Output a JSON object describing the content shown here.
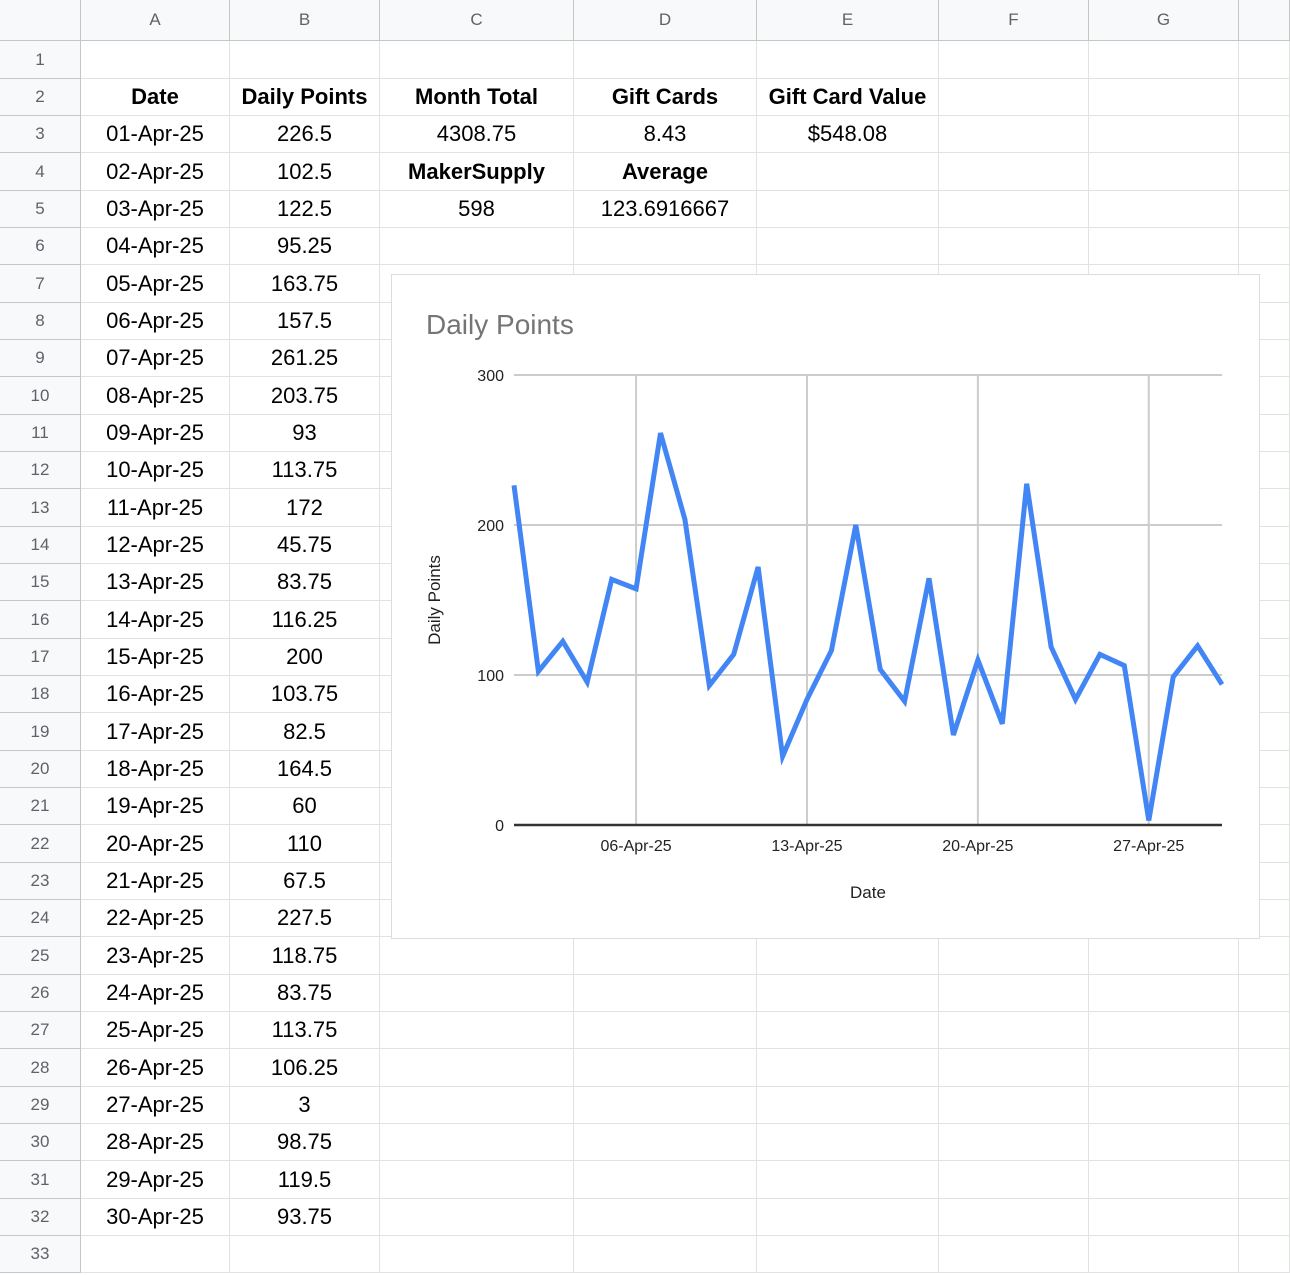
{
  "columns": [
    "A",
    "B",
    "C",
    "D",
    "E",
    "F",
    "G"
  ],
  "rows": [
    "1",
    "2",
    "3",
    "4",
    "5",
    "6",
    "7",
    "8",
    "9",
    "10",
    "11",
    "12",
    "13",
    "14",
    "15",
    "16",
    "17",
    "18",
    "19",
    "20",
    "21",
    "22",
    "23",
    "24",
    "25",
    "26",
    "27",
    "28",
    "29",
    "30",
    "31",
    "32",
    "33"
  ],
  "cells": {
    "A2": "Date",
    "B2": "Daily Points",
    "C2": "Month Total",
    "D2": "Gift Cards",
    "E2": "Gift Card Value",
    "C3": "4308.75",
    "D3": "8.43",
    "E3": "$548.08",
    "C4": "MakerSupply",
    "D4": "Average",
    "C5": "598",
    "D5": "123.6916667"
  },
  "bold_cells": [
    "A2",
    "B2",
    "C2",
    "D2",
    "E2",
    "C4",
    "D4"
  ],
  "table": {
    "dates": [
      "01-Apr-25",
      "02-Apr-25",
      "03-Apr-25",
      "04-Apr-25",
      "05-Apr-25",
      "06-Apr-25",
      "07-Apr-25",
      "08-Apr-25",
      "09-Apr-25",
      "10-Apr-25",
      "11-Apr-25",
      "12-Apr-25",
      "13-Apr-25",
      "14-Apr-25",
      "15-Apr-25",
      "16-Apr-25",
      "17-Apr-25",
      "18-Apr-25",
      "19-Apr-25",
      "20-Apr-25",
      "21-Apr-25",
      "22-Apr-25",
      "23-Apr-25",
      "24-Apr-25",
      "25-Apr-25",
      "26-Apr-25",
      "27-Apr-25",
      "28-Apr-25",
      "29-Apr-25",
      "30-Apr-25"
    ],
    "points": [
      "226.5",
      "102.5",
      "122.5",
      "95.25",
      "163.75",
      "157.5",
      "261.25",
      "203.75",
      "93",
      "113.75",
      "172",
      "45.75",
      "83.75",
      "116.25",
      "200",
      "103.75",
      "82.5",
      "164.5",
      "60",
      "110",
      "67.5",
      "227.5",
      "118.75",
      "83.75",
      "113.75",
      "106.25",
      "3",
      "98.75",
      "119.5",
      "93.75"
    ]
  },
  "chart_data": {
    "type": "line",
    "title": "Daily Points",
    "xlabel": "Date",
    "ylabel": "Daily Points",
    "ylim": [
      0,
      300
    ],
    "yticks": [
      0,
      100,
      200,
      300
    ],
    "xticks": [
      "06-Apr-25",
      "13-Apr-25",
      "20-Apr-25",
      "27-Apr-25"
    ],
    "grid": true,
    "line_color": "#4285f4",
    "x": [
      "01-Apr-25",
      "02-Apr-25",
      "03-Apr-25",
      "04-Apr-25",
      "05-Apr-25",
      "06-Apr-25",
      "07-Apr-25",
      "08-Apr-25",
      "09-Apr-25",
      "10-Apr-25",
      "11-Apr-25",
      "12-Apr-25",
      "13-Apr-25",
      "14-Apr-25",
      "15-Apr-25",
      "16-Apr-25",
      "17-Apr-25",
      "18-Apr-25",
      "19-Apr-25",
      "20-Apr-25",
      "21-Apr-25",
      "22-Apr-25",
      "23-Apr-25",
      "24-Apr-25",
      "25-Apr-25",
      "26-Apr-25",
      "27-Apr-25",
      "28-Apr-25",
      "29-Apr-25",
      "30-Apr-25"
    ],
    "series": [
      {
        "values": [
          226.5,
          102.5,
          122.5,
          95.25,
          163.75,
          157.5,
          261.25,
          203.75,
          93,
          113.75,
          172,
          45.75,
          83.75,
          116.25,
          200,
          103.75,
          82.5,
          164.5,
          60,
          110,
          67.5,
          227.5,
          118.75,
          83.75,
          113.75,
          106.25,
          3,
          98.75,
          119.5,
          93.75
        ]
      }
    ]
  }
}
